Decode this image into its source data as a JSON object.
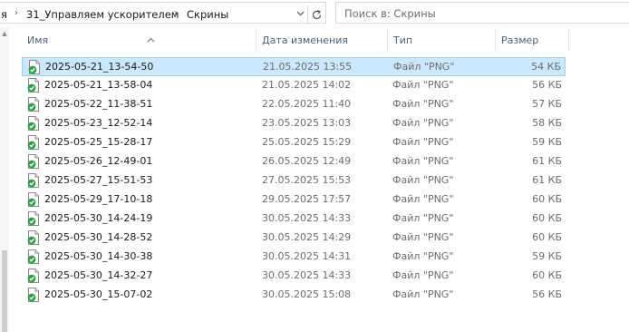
{
  "address": {
    "crumbs": [
      "я",
      "31_Управляем ускорителем",
      "Скрины"
    ],
    "separator": "›"
  },
  "search": {
    "placeholder": "Поиск в: Скрины"
  },
  "columns": {
    "name": "Имя",
    "date": "Дата изменения",
    "type": "Тип",
    "size": "Размер"
  },
  "files": [
    {
      "name": "2025-05-21_13-54-50",
      "date": "21.05.2025 13:55",
      "type": "Файл \"PNG\"",
      "size": "54 КБ",
      "selected": true
    },
    {
      "name": "2025-05-21_13-58-04",
      "date": "21.05.2025 14:02",
      "type": "Файл \"PNG\"",
      "size": "56 КБ"
    },
    {
      "name": "2025-05-22_11-38-51",
      "date": "22.05.2025 11:40",
      "type": "Файл \"PNG\"",
      "size": "57 КБ"
    },
    {
      "name": "2025-05-23_12-52-14",
      "date": "23.05.2025 13:03",
      "type": "Файл \"PNG\"",
      "size": "58 КБ"
    },
    {
      "name": "2025-05-25_15-28-17",
      "date": "25.05.2025 15:29",
      "type": "Файл \"PNG\"",
      "size": "59 КБ"
    },
    {
      "name": "2025-05-26_12-49-01",
      "date": "26.05.2025 12:49",
      "type": "Файл \"PNG\"",
      "size": "61 КБ"
    },
    {
      "name": "2025-05-27_15-51-53",
      "date": "27.05.2025 15:53",
      "type": "Файл \"PNG\"",
      "size": "61 КБ"
    },
    {
      "name": "2025-05-29_17-10-18",
      "date": "29.05.2025 17:57",
      "type": "Файл \"PNG\"",
      "size": "60 КБ"
    },
    {
      "name": "2025-05-30_14-24-19",
      "date": "30.05.2025 14:33",
      "type": "Файл \"PNG\"",
      "size": "60 КБ"
    },
    {
      "name": "2025-05-30_14-28-52",
      "date": "30.05.2025 14:29",
      "type": "Файл \"PNG\"",
      "size": "60 КБ"
    },
    {
      "name": "2025-05-30_14-30-38",
      "date": "30.05.2025 14:31",
      "type": "Файл \"PNG\"",
      "size": "59 КБ"
    },
    {
      "name": "2025-05-30_14-32-27",
      "date": "30.05.2025 14:33",
      "type": "Файл \"PNG\"",
      "size": "60 КБ"
    },
    {
      "name": "2025-05-30_15-07-02",
      "date": "30.05.2025 15:08",
      "type": "Файл \"PNG\"",
      "size": "56 КБ"
    }
  ],
  "icons": {
    "file": "png-file-icon",
    "sync_badge": "sync-ok-check-icon",
    "refresh": "refresh-icon",
    "dropdown": "chevron-down-icon",
    "sort": "sort-ascending-icon"
  },
  "colors": {
    "selection_bg": "#cce8ff",
    "selection_border": "#99d1ff",
    "header_text": "#4c607a",
    "sync_green": "#2ea043"
  }
}
